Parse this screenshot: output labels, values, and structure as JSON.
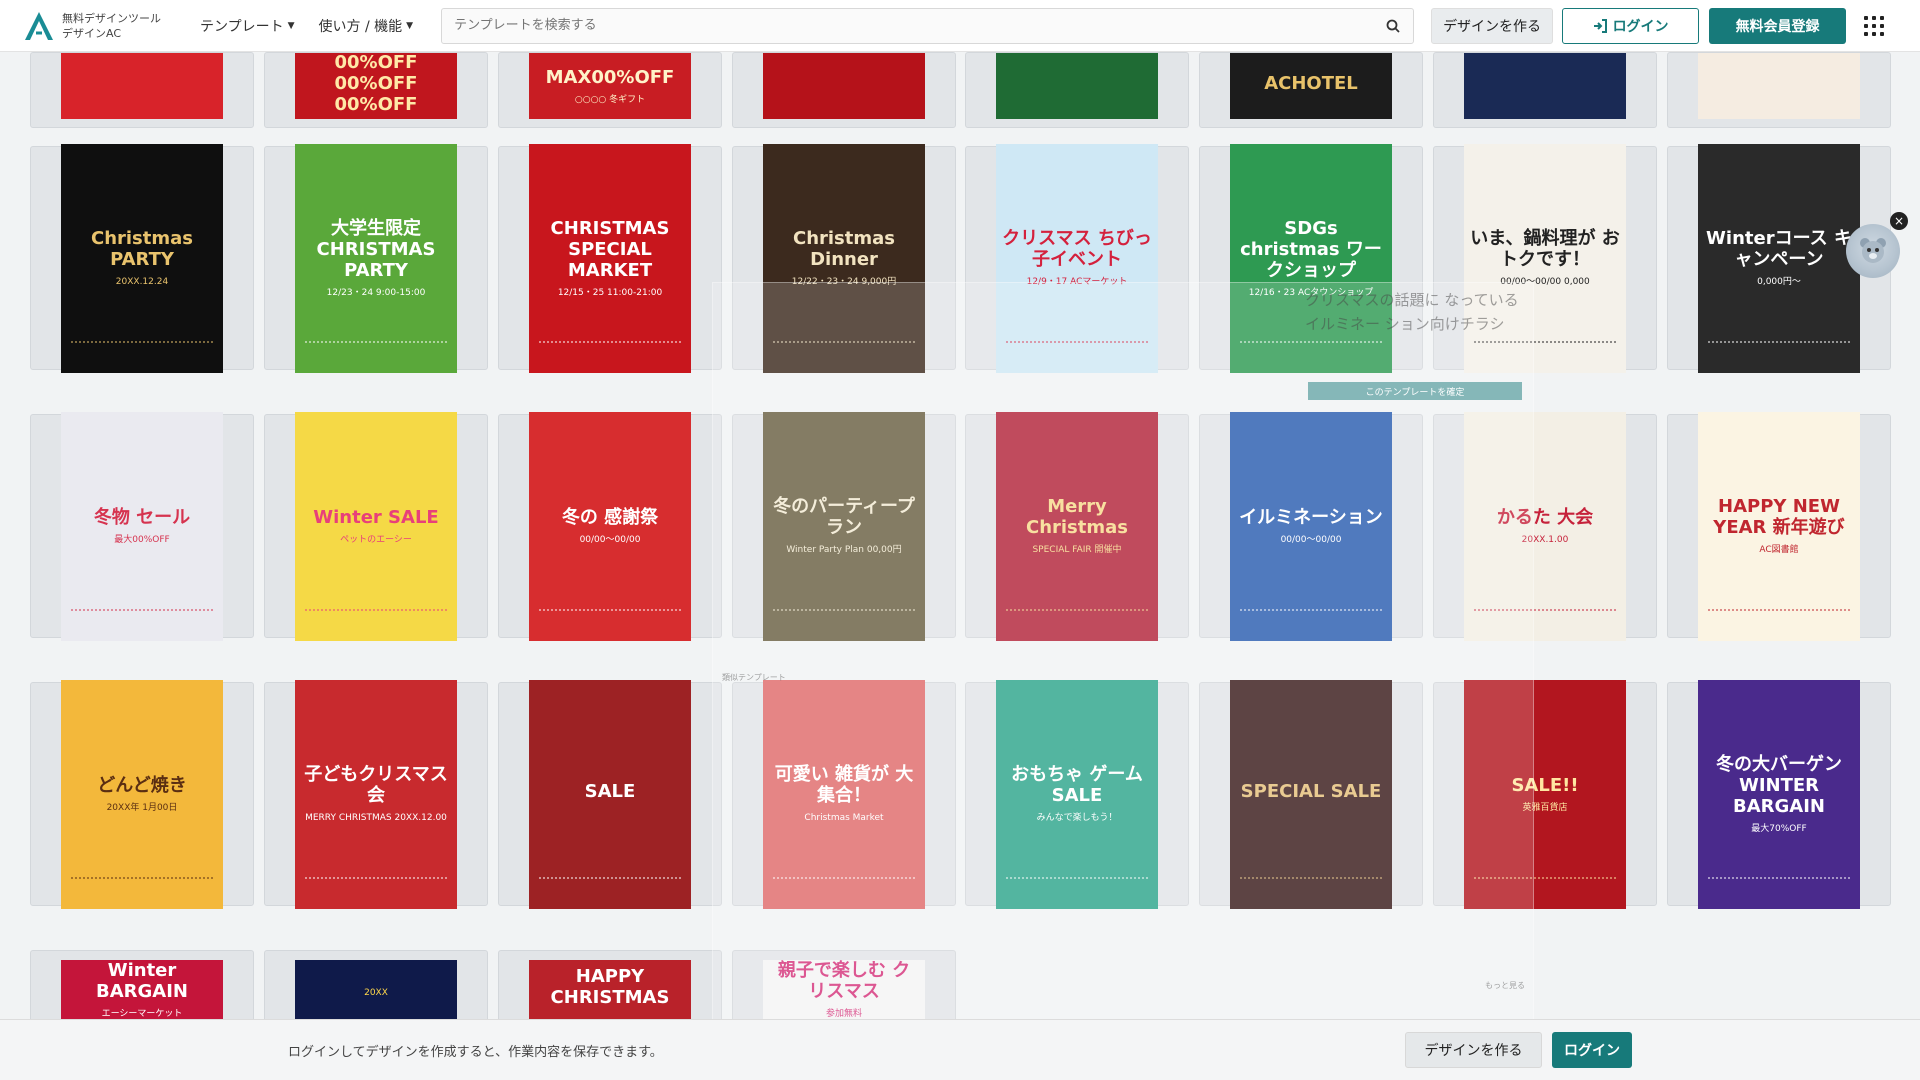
{
  "header": {
    "logo_line1": "無料デザインツール",
    "logo_line2": "デザインAC",
    "nav": [
      {
        "label": "テンプレート"
      },
      {
        "label": "使い方 / 機能"
      }
    ],
    "search_placeholder": "テンプレートを検索する",
    "create_label": "デザインを作る",
    "login_label": "ログイン",
    "register_label": "無料会員登録"
  },
  "flyers": {
    "row0": [
      {
        "title": "",
        "sub": "",
        "bg": "#d8232a",
        "fg": "#ffffff"
      },
      {
        "title": "00%OFF 00%OFF 00%OFF",
        "sub": "",
        "bg": "#c0161e",
        "fg": "#ffe9a8"
      },
      {
        "title": "MAX00%OFF",
        "sub": "○○○○ 冬ギフト",
        "bg": "#c81d23",
        "fg": "#fff3c9"
      },
      {
        "title": "",
        "sub": "",
        "bg": "#b5121a",
        "fg": "#ffffff"
      },
      {
        "title": "",
        "sub": "",
        "bg": "#1f6b34",
        "fg": "#ffffff"
      },
      {
        "title": "ACHOTEL",
        "sub": "",
        "bg": "#1c1c1c",
        "fg": "#e8c26a"
      },
      {
        "title": "",
        "sub": "",
        "bg": "#1a2a55",
        "fg": "#ffd36a"
      },
      {
        "title": "",
        "sub": "",
        "bg": "#f5ece1",
        "fg": "#b81d24"
      }
    ],
    "row1": [
      {
        "title": "Christmas PARTY",
        "sub": "20XX.12.24",
        "bg": "#0f0f0f",
        "fg": "#e9c36d"
      },
      {
        "title": "大学生限定 CHRISTMAS PARTY",
        "sub": "12/23・24 9:00-15:00",
        "bg": "#5aa83a",
        "fg": "#ffffff"
      },
      {
        "title": "CHRISTMAS SPECIAL MARKET",
        "sub": "12/15・25 11:00-21:00",
        "bg": "#c8161d",
        "fg": "#ffffff"
      },
      {
        "title": "Christmas Dinner",
        "sub": "12/22・23・24 9,000円",
        "bg": "#3c2a1e",
        "fg": "#f2e3c0"
      },
      {
        "title": "クリスマス ちびっ子イベント",
        "sub": "12/9・17 ACマーケット",
        "bg": "#cfe8f5",
        "fg": "#d4213d"
      },
      {
        "title": "SDGs christmas ワークショップ",
        "sub": "12/16・23 ACタウンショップ",
        "bg": "#2e9a52",
        "fg": "#ffffff"
      },
      {
        "title": "いま、鍋料理が おトクです！",
        "sub": "00/00〜00/00 0,000",
        "bg": "#f4f1ea",
        "fg": "#222222"
      },
      {
        "title": "Winterコース キャンペーン",
        "sub": "0,000円〜",
        "bg": "#2a2a2a",
        "fg": "#ffffff"
      }
    ],
    "row2": [
      {
        "title": "冬物 セール",
        "sub": "最大00%OFF",
        "bg": "#eaeaf0",
        "fg": "#d6334f"
      },
      {
        "title": "Winter SALE",
        "sub": "ペットのエーシー",
        "bg": "#f5d946",
        "fg": "#e8407a"
      },
      {
        "title": "冬の 感謝祭",
        "sub": "00/00〜00/00",
        "bg": "#d72d2f",
        "fg": "#ffffff"
      },
      {
        "title": "冬のパーティープラン",
        "sub": "Winter Party Plan 00,00円",
        "bg": "#6a6042",
        "fg": "#f2ead2"
      },
      {
        "title": "Merry Christmas",
        "sub": "SPECIAL FAIR 開催中",
        "bg": "#b2243a",
        "fg": "#f7d98c"
      },
      {
        "title": "イルミネーション",
        "sub": "00/00〜00/00",
        "bg": "#2a5db0",
        "fg": "#ffffff"
      },
      {
        "title": "かるた 大会",
        "sub": "20XX.1.00",
        "bg": "#f3efe5",
        "fg": "#c6223b"
      },
      {
        "title": "HAPPY NEW YEAR 新年遊び",
        "sub": "AC図書館",
        "bg": "#fbf4e3",
        "fg": "#c0262f"
      }
    ],
    "row3": [
      {
        "title": "どんど焼き",
        "sub": "20XX年 1月00日",
        "bg": "#f3b83b",
        "fg": "#5a2e12"
      },
      {
        "title": "子どもクリスマス会",
        "sub": "MERRY CHRISTMAS 20XX.12.00",
        "bg": "#c82a2e",
        "fg": "#ffffff"
      },
      {
        "title": "SALE",
        "sub": "",
        "bg": "#9d2224",
        "fg": "#ffffff"
      },
      {
        "title": "可愛い 雑貨が 大集合！",
        "sub": "Christmas Market",
        "bg": "#e06b6b",
        "fg": "#ffffff"
      },
      {
        "title": "おもちゃ ゲームSALE",
        "sub": "みんなで楽しもう！",
        "bg": "#2ea58b",
        "fg": "#ffffff"
      },
      {
        "title": "SPECIAL SALE",
        "sub": "",
        "bg": "#3a1c1c",
        "fg": "#e5c07a"
      },
      {
        "title": "SALE!!",
        "sub": "英雅百貨店",
        "bg": "#b2161f",
        "fg": "#ffe6a1"
      },
      {
        "title": "冬の大バーゲン WINTER BARGAIN",
        "sub": "最大70%OFF",
        "bg": "#4a2a8c",
        "fg": "#ffffff"
      }
    ],
    "row4": [
      {
        "title": "Winter BARGAIN",
        "sub": "エーシーマーケット",
        "bg": "#c4153a",
        "fg": "#ffffff"
      },
      {
        "title": "",
        "sub": "20XX",
        "bg": "#0f1a4a",
        "fg": "#ffd84a"
      },
      {
        "title": "HAPPY CHRISTMAS",
        "sub": "",
        "bg": "#b9222a",
        "fg": "#ffffff"
      },
      {
        "title": "親子で楽しむ クリスマス",
        "sub": "参加無料",
        "bg": "#f5f5f5",
        "fg": "#d5327a"
      }
    ]
  },
  "overlay": {
    "text": "クリスマスの話題に なっているイルミネー ション向けチラシ",
    "button": "このテンプレートを確定",
    "label": "類似テンプレート",
    "more": "もっと見る"
  },
  "footer": {
    "message": "ログインしてデザインを作成すると、作業内容を保存できます。",
    "create_label": "デザインを作る",
    "login_label": "ログイン"
  },
  "colors": {
    "accent": "#177a7a",
    "page_bg": "#f1f3f4"
  }
}
